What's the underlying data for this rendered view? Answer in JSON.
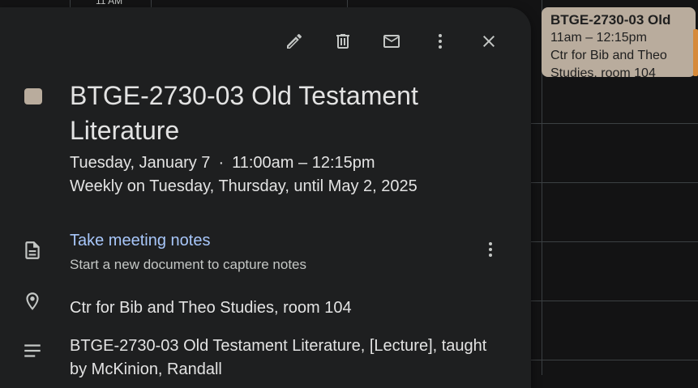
{
  "calendar": {
    "time_label": "11 AM",
    "event_chip": {
      "title": "BTGE-2730-03 Old",
      "time": "11am – 12:15pm",
      "location_line1": "Ctr for Bib and Theo",
      "location_line2": "Studies, room 104",
      "color": "#b9ac9d"
    }
  },
  "dialog": {
    "toolbar": {
      "edit_icon": "pencil-icon",
      "delete_icon": "trash-icon",
      "email_icon": "mail-icon",
      "options_icon": "more-vert-icon",
      "close_icon": "close-icon"
    },
    "event_color": "#b9ac9d",
    "title": "BTGE-2730-03 Old Testament Literature",
    "date": "Tuesday, January 7",
    "separator": "·",
    "time": "11:00am – 12:15pm",
    "recurrence": "Weekly on Tuesday, Thursday, until May 2, 2025",
    "notes": {
      "icon": "document-icon",
      "link_label": "Take meeting notes",
      "subtitle": "Start a new document to capture notes"
    },
    "location": {
      "icon": "location-pin-icon",
      "text": "Ctr for Bib and Theo Studies, room 104"
    },
    "description": {
      "icon": "notes-lines-icon",
      "text": "BTGE-2730-03 Old Testament Literature, [Lecture], taught by McKinion, Randall"
    }
  }
}
